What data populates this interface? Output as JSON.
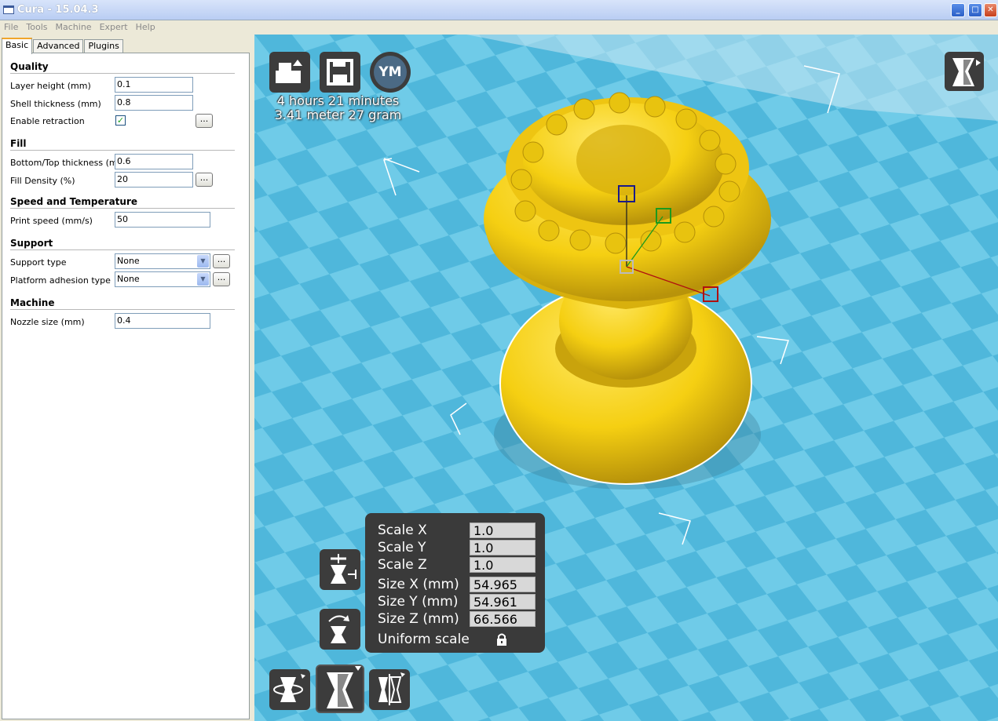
{
  "window": {
    "title": "Cura - 15.04.3"
  },
  "menu": [
    "File",
    "Tools",
    "Machine",
    "Expert",
    "Help"
  ],
  "tabs": [
    "Basic",
    "Advanced",
    "Plugins"
  ],
  "sections": {
    "quality": "Quality",
    "fill": "Fill",
    "speed": "Speed and Temperature",
    "support": "Support",
    "machine": "Machine"
  },
  "fields": {
    "layer_height": {
      "label": "Layer height (mm)",
      "value": "0.1"
    },
    "shell_thickness": {
      "label": "Shell thickness (mm)",
      "value": "0.8"
    },
    "enable_retraction": {
      "label": "Enable retraction",
      "checked": true
    },
    "bottom_top": {
      "label": "Bottom/Top thickness (mm)",
      "value": "0.6"
    },
    "fill_density": {
      "label": "Fill Density (%)",
      "value": "20"
    },
    "print_speed": {
      "label": "Print speed (mm/s)",
      "value": "50"
    },
    "support_type": {
      "label": "Support type",
      "value": "None"
    },
    "platform_adhesion": {
      "label": "Platform adhesion type",
      "value": "None"
    },
    "nozzle_size": {
      "label": "Nozzle size (mm)",
      "value": "0.4"
    }
  },
  "dots_label": "...",
  "viewport": {
    "ym_label": "YM",
    "estimate_time": "4 hours 21 minutes",
    "estimate_material": "3.41 meter 27 gram",
    "scale": {
      "rows": [
        {
          "label": "Scale X",
          "value": "1.0"
        },
        {
          "label": "Scale Y",
          "value": "1.0"
        },
        {
          "label": "Scale Z",
          "value": "1.0"
        },
        {
          "label": "Size X (mm)",
          "value": "54.965"
        },
        {
          "label": "Size Y (mm)",
          "value": "54.961"
        },
        {
          "label": "Size Z (mm)",
          "value": "66.566"
        }
      ],
      "uniform": "Uniform scale"
    },
    "bed_color": "#66c8e6",
    "model_color": "#f5cf12"
  }
}
